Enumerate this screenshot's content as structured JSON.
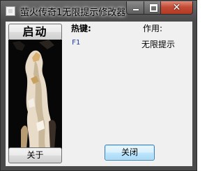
{
  "window": {
    "title": "萤火传奇1无限提示修改器",
    "close_glyph": "✕"
  },
  "buttons": {
    "start_label": "启动",
    "about_label": "关于",
    "close_label": "关闭"
  },
  "hotkeys": {
    "header_hotkey": "热键:",
    "header_effect": "作用:",
    "rows": [
      {
        "key": "F1",
        "effect": "无限提示"
      }
    ]
  },
  "colors": {
    "titlebar": "#4a4a4a",
    "client_bg": "#f0f0f0",
    "close_button": "#c44c36",
    "hotkey_key_text": "#1a3a9c",
    "focused_button_border": "#3c7fb1"
  },
  "icons": {
    "app": "app-icon",
    "minimize": "minimize-icon",
    "maximize": "maximize-icon",
    "close": "close-icon"
  }
}
